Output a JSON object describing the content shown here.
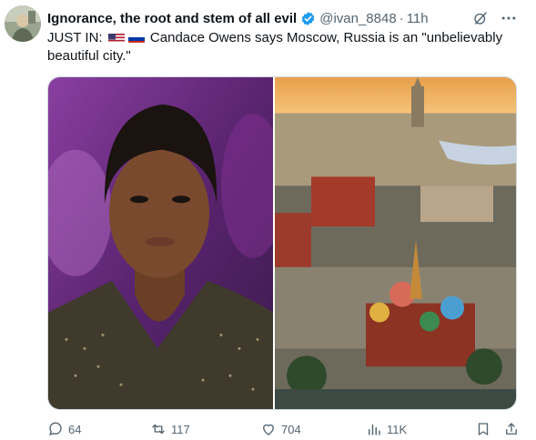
{
  "author": {
    "display_name": "Ignorance, the root and stem of all evil",
    "handle": "@ivan_8848",
    "separator": "·",
    "time": "11h",
    "verified": true
  },
  "tweet": {
    "prefix": "JUST IN:",
    "flags": [
      "us-flag",
      "russia-flag"
    ],
    "body": "Candace Owens says Moscow, Russia is an \"unbelievably beautiful city.\""
  },
  "media": {
    "left_photo": "portrait-photo",
    "right_photo": "moscow-aerial-photo"
  },
  "actions": {
    "replies": "64",
    "reposts": "117",
    "likes": "704",
    "views": "11K"
  },
  "colors": {
    "text": "#0f1419",
    "secondary": "#536471",
    "verified": "#1d9bf0",
    "border": "#cfd9de"
  }
}
